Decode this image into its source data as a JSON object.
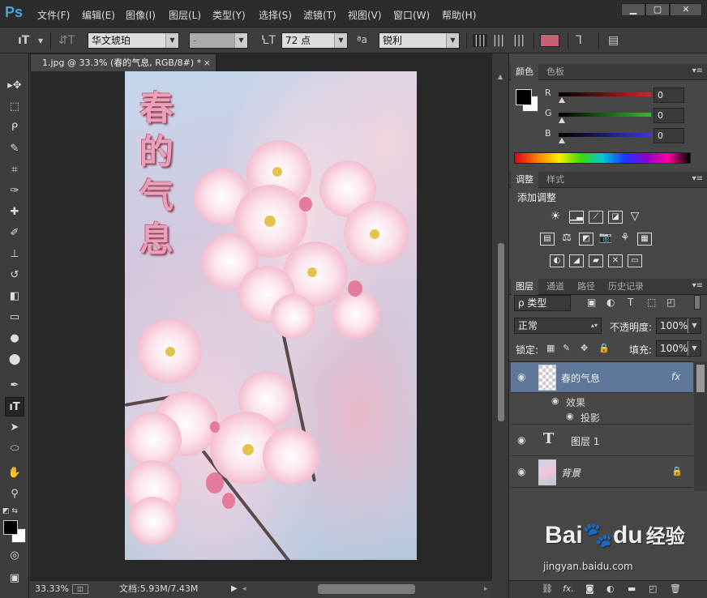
{
  "app": {
    "logo": "Ps"
  },
  "menu": [
    "文件(F)",
    "编辑(E)",
    "图像(I)",
    "图层(L)",
    "类型(Y)",
    "选择(S)",
    "滤镜(T)",
    "视图(V)",
    "窗口(W)",
    "帮助(H)"
  ],
  "window_controls": {
    "minimize": "▁",
    "restore": "▢",
    "close": "✕"
  },
  "options": {
    "tool_glyph": "ıT",
    "font_family": "华文琥珀",
    "font_style": "-",
    "font_size": "72 点",
    "aa_label": "ªa",
    "aa_mode": "锐利",
    "text_color": "#c96070"
  },
  "document": {
    "tab_title": "1.jpg @ 33.3% (春的气息, RGB/8#) *",
    "tab_close": "×",
    "vertical_text": [
      "春",
      "的",
      "气",
      "息"
    ]
  },
  "status": {
    "zoom": "33.33%",
    "doc_info": "文档:5.93M/7.43M",
    "play_icon": "▶"
  },
  "color_panel": {
    "tabs": [
      "颜色",
      "色板"
    ],
    "channels": [
      {
        "label": "R",
        "value": "0",
        "color": "#cc2a2a"
      },
      {
        "label": "G",
        "value": "0",
        "color": "#2fbf2f"
      },
      {
        "label": "B",
        "value": "0",
        "color": "#3a3ad0"
      }
    ]
  },
  "adjust_panel": {
    "tabs": [
      "调整",
      "样式"
    ],
    "title": "添加调整"
  },
  "layers_panel": {
    "tabs": [
      "图层",
      "通道",
      "路径",
      "历史记录"
    ],
    "filter_kind": "ρ 类型",
    "blend_mode": "正常",
    "opacity_label": "不透明度:",
    "opacity_value": "100%",
    "lock_label": "锁定:",
    "fill_label": "填充:",
    "fill_value": "100%",
    "layers": [
      {
        "name": "春的气息",
        "fx": "fx",
        "selected": true
      },
      {
        "name": "图层 1",
        "type_glyph": "T"
      },
      {
        "name": "背景",
        "lock": "🔒"
      }
    ],
    "effects_label": "效果",
    "effect_item": "投影"
  },
  "watermark": {
    "brand": "Bai",
    "paw": "du",
    "cn": "经验",
    "url": "jingyan.baidu.com"
  }
}
